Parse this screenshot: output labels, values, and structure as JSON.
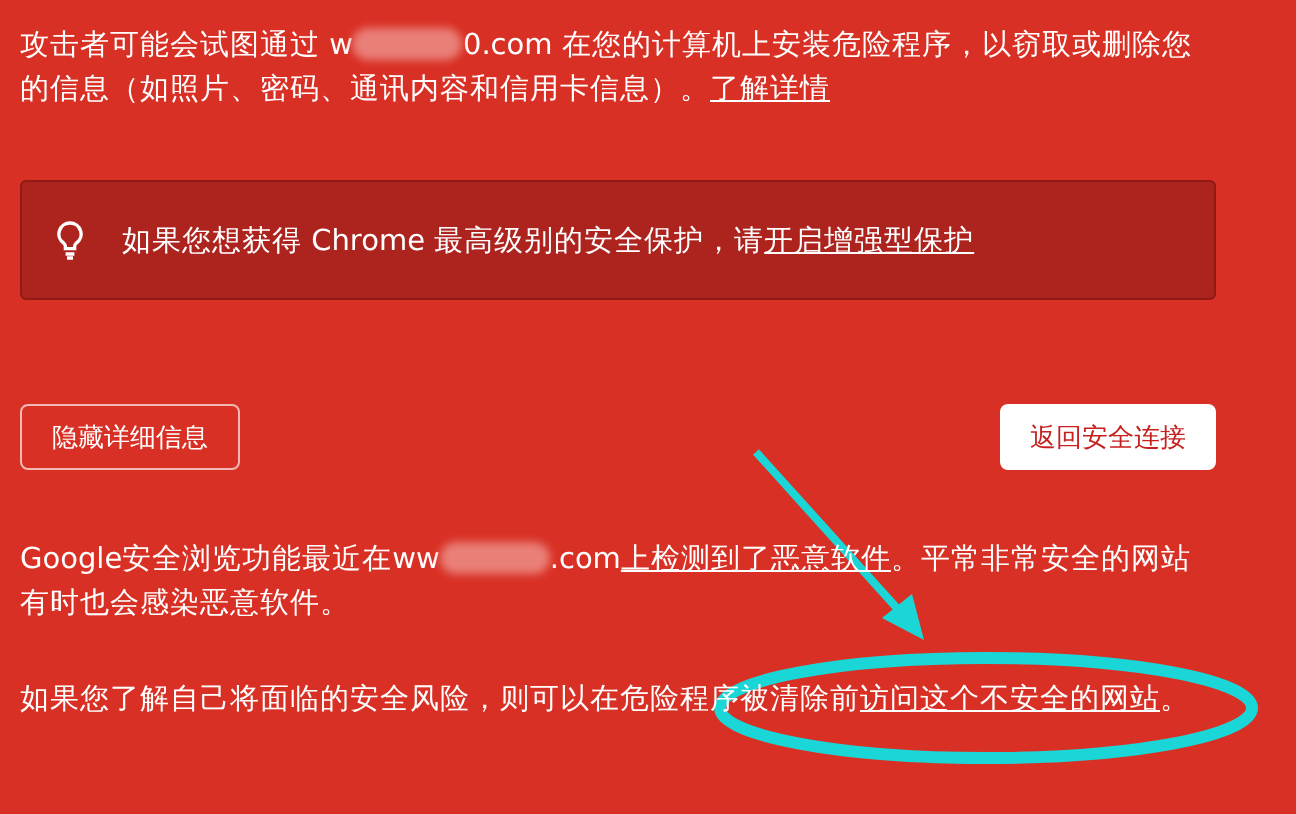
{
  "intro": {
    "before": "攻击者可能会试图通过 w",
    "after": "0.com 在您的计算机上安装危险程序，以窃取或删除您的信息（如照片、密码、通讯内容和信用卡信息）。",
    "link": "了解详情"
  },
  "tip": {
    "text": "如果您想获得 Chrome 最高级别的安全保护，请",
    "link": "开启增强型保护"
  },
  "buttons": [
    {
      "label": "隐藏详细信息",
      "kind": "outline"
    },
    {
      "label": "返回安全连接",
      "kind": "primary"
    }
  ],
  "details": [
    {
      "before": "Google安全浏览功能最近在ww",
      "after": ".com",
      "link": "上检测到了恶意软件",
      "rest": "。平常非常安全的网站有时也会感染恶意软件。"
    },
    {
      "before": "如果您了解自己将面临的安全风险，则可以在危险程序被清除前",
      "link": "访问这个不安全的网站",
      "rest": "。"
    }
  ]
}
